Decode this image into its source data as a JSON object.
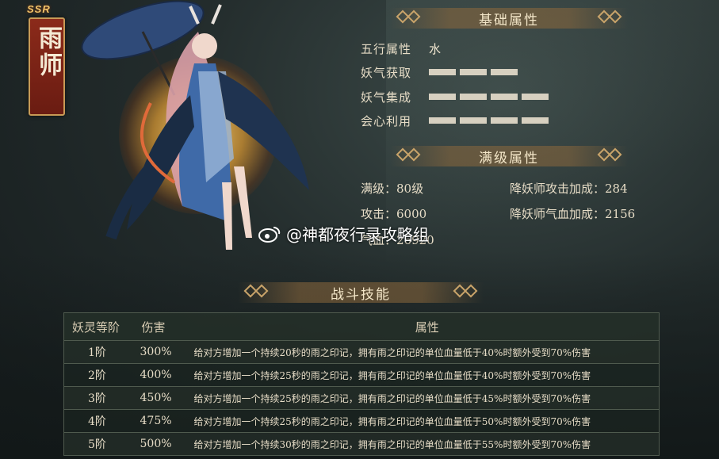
{
  "character": {
    "rarity": "SSR",
    "name": "雨师"
  },
  "basic_attributes": {
    "title": "基础属性",
    "element_label": "五行属性",
    "element_value": "水",
    "gain_label": "妖气获取",
    "gain_level": 3,
    "gather_label": "妖气集成",
    "gather_level": 4,
    "crit_label": "会心利用",
    "crit_level": 4,
    "max_level": 4
  },
  "max_attributes": {
    "title": "满级属性",
    "level": "满级：80级",
    "attack": "攻击：6000",
    "hp": "气血：26920",
    "atk_bonus": "降妖师攻击加成：284",
    "hp_bonus": "降妖师气血加成：2156"
  },
  "skills": {
    "title": "战斗技能",
    "headers": [
      "妖灵等阶",
      "伤害",
      "属性"
    ],
    "rows": [
      {
        "level": "1阶",
        "damage": "300%",
        "desc": "给对方增加一个持续20秒的雨之印记，拥有雨之印记的单位血量低于40%时额外受到70%伤害"
      },
      {
        "level": "2阶",
        "damage": "400%",
        "desc": "给对方增加一个持续25秒的雨之印记，拥有雨之印记的单位血量低于40%时额外受到70%伤害"
      },
      {
        "level": "3阶",
        "damage": "450%",
        "desc": "给对方增加一个持续25秒的雨之印记，拥有雨之印记的单位血量低于45%时额外受到70%伤害"
      },
      {
        "level": "4阶",
        "damage": "475%",
        "desc": "给对方增加一个持续25秒的雨之印记，拥有雨之印记的单位血量低于50%时额外受到70%伤害"
      },
      {
        "level": "5阶",
        "damage": "500%",
        "desc": "给对方增加一个持续30秒的雨之印记，拥有雨之印记的单位血量低于55%时额外受到70%伤害"
      }
    ]
  },
  "watermark": "@神都夜行录攻略组",
  "icons": {
    "weibo": "weibo-icon",
    "ornament": "diamond-ornament-icon"
  },
  "colors": {
    "banner": "#8b2a1a",
    "gold": "#c9a46a",
    "bar": "#d7d0c0"
  }
}
